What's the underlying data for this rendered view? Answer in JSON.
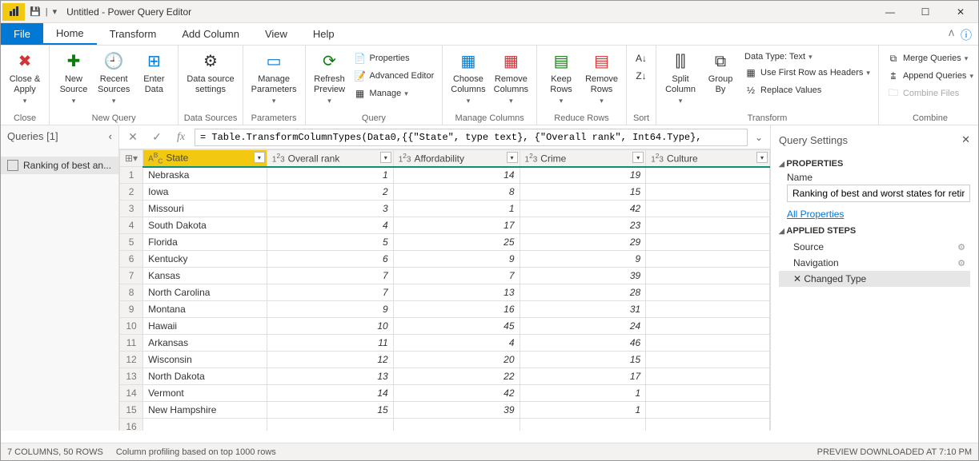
{
  "window": {
    "title": "Untitled - Power Query Editor"
  },
  "tabs": {
    "file": "File",
    "home": "Home",
    "transform": "Transform",
    "addcolumn": "Add Column",
    "view": "View",
    "help": "Help"
  },
  "ribbon": {
    "close": {
      "closeapply": "Close &\nApply",
      "group": "Close"
    },
    "newquery": {
      "newsource": "New\nSource",
      "recent": "Recent\nSources",
      "enterdata": "Enter\nData",
      "group": "New Query"
    },
    "datasources": {
      "settings": "Data source\nsettings",
      "group": "Data Sources"
    },
    "parameters": {
      "manage": "Manage\nParameters",
      "group": "Parameters"
    },
    "query": {
      "refresh": "Refresh\nPreview",
      "properties": "Properties",
      "advanced": "Advanced Editor",
      "manage": "Manage",
      "group": "Query"
    },
    "managecols": {
      "choose": "Choose\nColumns",
      "remove": "Remove\nColumns",
      "group": "Manage Columns"
    },
    "reducerows": {
      "keep": "Keep\nRows",
      "removerows": "Remove\nRows",
      "group": "Reduce Rows"
    },
    "sort": {
      "group": "Sort"
    },
    "transform": {
      "split": "Split\nColumn",
      "groupby": "Group\nBy",
      "datatype": "Data Type: Text",
      "firstrow": "Use First Row as Headers",
      "replace": "Replace Values",
      "group": "Transform"
    },
    "combine": {
      "merge": "Merge Queries",
      "append": "Append Queries",
      "combinefiles": "Combine Files",
      "group": "Combine"
    }
  },
  "queries": {
    "header": "Queries [1]",
    "item": "Ranking of best an..."
  },
  "formula": "= Table.TransformColumnTypes(Data0,{{\"State\", type text}, {\"Overall rank\", Int64.Type},",
  "columns": {
    "state": "State",
    "overall": "Overall rank",
    "afford": "Affordability",
    "crime": "Crime",
    "culture": "Culture"
  },
  "chart_data": {
    "type": "table",
    "columns": [
      "State",
      "Overall rank",
      "Affordability",
      "Crime",
      "Culture"
    ],
    "rows": [
      {
        "state": "Nebraska",
        "overall": 1,
        "afford": 14,
        "crime": 19,
        "culture": ""
      },
      {
        "state": "Iowa",
        "overall": 2,
        "afford": 8,
        "crime": 15,
        "culture": ""
      },
      {
        "state": "Missouri",
        "overall": 3,
        "afford": 1,
        "crime": 42,
        "culture": ""
      },
      {
        "state": "South Dakota",
        "overall": 4,
        "afford": 17,
        "crime": 23,
        "culture": ""
      },
      {
        "state": "Florida",
        "overall": 5,
        "afford": 25,
        "crime": 29,
        "culture": ""
      },
      {
        "state": "Kentucky",
        "overall": 6,
        "afford": 9,
        "crime": 9,
        "culture": ""
      },
      {
        "state": "Kansas",
        "overall": 7,
        "afford": 7,
        "crime": 39,
        "culture": ""
      },
      {
        "state": "North Carolina",
        "overall": 7,
        "afford": 13,
        "crime": 28,
        "culture": ""
      },
      {
        "state": "Montana",
        "overall": 9,
        "afford": 16,
        "crime": 31,
        "culture": ""
      },
      {
        "state": "Hawaii",
        "overall": 10,
        "afford": 45,
        "crime": 24,
        "culture": ""
      },
      {
        "state": "Arkansas",
        "overall": 11,
        "afford": 4,
        "crime": 46,
        "culture": ""
      },
      {
        "state": "Wisconsin",
        "overall": 12,
        "afford": 20,
        "crime": 15,
        "culture": ""
      },
      {
        "state": "North Dakota",
        "overall": 13,
        "afford": 22,
        "crime": 17,
        "culture": ""
      },
      {
        "state": "Vermont",
        "overall": 14,
        "afford": 42,
        "crime": 1,
        "culture": ""
      },
      {
        "state": "New Hampshire",
        "overall": 15,
        "afford": 39,
        "crime": 1,
        "culture": ""
      }
    ]
  },
  "settings": {
    "header": "Query Settings",
    "properties": "PROPERTIES",
    "namelabel": "Name",
    "namevalue": "Ranking of best and worst states for retire",
    "allprops": "All Properties",
    "appliedsteps": "APPLIED STEPS",
    "steps": [
      "Source",
      "Navigation",
      "Changed Type"
    ]
  },
  "status": {
    "left": "7 COLUMNS, 50 ROWS",
    "mid": "Column profiling based on top 1000 rows",
    "right": "PREVIEW DOWNLOADED AT 7:10 PM"
  }
}
